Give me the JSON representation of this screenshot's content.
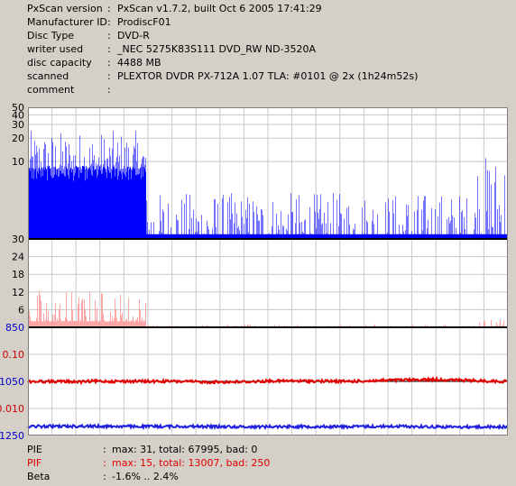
{
  "info": [
    {
      "key": "PxScan version",
      "value": "PxScan v1.7.2, built Oct  6 2005 17:41:29"
    },
    {
      "key": "Manufacturer ID",
      "value": "ProdiscF01"
    },
    {
      "key": "Disc Type",
      "value": "DVD-R"
    },
    {
      "key": "writer used",
      "value": "_NEC 5275K83S111 DVD_RW ND-3520A"
    },
    {
      "key": "disc capacity",
      "value": "4488 MB"
    },
    {
      "key": "scanned",
      "value": "PLEXTOR DVDR PX-712A 1.07 TLA: #0101 @ 2x (1h24m52s)"
    },
    {
      "key": "comment",
      "value": ""
    }
  ],
  "stats": [
    {
      "key": "PIE",
      "value": "max: 31, total: 67995, bad: 0",
      "color": "#000000"
    },
    {
      "key": "PIF",
      "value": "max: 15, total: 13007, bad: 250",
      "color": "#e00000"
    },
    {
      "key": "Beta",
      "value": "-1.6% .. 2.4%",
      "color": "#000000"
    }
  ],
  "chart_data": [
    {
      "type": "area",
      "scale": "log",
      "ylim": [
        1,
        50
      ],
      "ytick_labels": [
        "50",
        "40",
        "30",
        "20",
        "10"
      ],
      "color": "#0000ff",
      "x_range": [
        0,
        4488
      ],
      "max": 31,
      "segments": [
        {
          "x": [
            0,
            1100
          ],
          "typical": 8,
          "peak": 25
        },
        {
          "x": [
            1100,
            4180
          ],
          "typical": 1,
          "peak": 4
        },
        {
          "x": [
            4180,
            4488
          ],
          "typical": 1,
          "peak": 12
        }
      ]
    },
    {
      "type": "area",
      "ylim": [
        0,
        30
      ],
      "ytick_labels": [
        "30",
        "24",
        "18",
        "12",
        "6"
      ],
      "color": "#ff9090",
      "x_range": [
        0,
        4488
      ],
      "max": 15,
      "segments": [
        {
          "x": [
            0,
            1100
          ],
          "typical": 2,
          "peak": 14
        },
        {
          "x": [
            1100,
            4180
          ],
          "typical": 0,
          "peak": 1
        },
        {
          "x": [
            4180,
            4488
          ],
          "typical": 0,
          "peak": 3
        }
      ]
    },
    {
      "type": "line",
      "ytick_labels": [
        "850",
        "0.10",
        "1050",
        "-0.010",
        "1250"
      ],
      "ytick_colors": [
        "#0000cc",
        "#cc0000",
        "#0000cc",
        "#cc0000",
        "#0000cc"
      ],
      "x_range": [
        0,
        4488
      ],
      "series": [
        {
          "color": "#e00000",
          "points": [
            [
              0,
              1.7
            ],
            [
              400,
              1.6
            ],
            [
              500,
              1.4
            ],
            [
              600,
              1.8
            ],
            [
              1400,
              1.7
            ],
            [
              1700,
              1.3
            ],
            [
              2000,
              1.4
            ],
            [
              2300,
              2.0
            ],
            [
              2800,
              1.8
            ],
            [
              3000,
              1.7
            ],
            [
              3400,
              2.4
            ],
            [
              3800,
              2.9
            ],
            [
              4100,
              2.3
            ],
            [
              4488,
              1.6
            ]
          ]
        },
        {
          "color": "#2020e0",
          "points": [
            [
              0,
              -1.0
            ],
            [
              500,
              -0.8
            ],
            [
              1000,
              -1.0
            ],
            [
              1500,
              -0.9
            ],
            [
              2000,
              -1.2
            ],
            [
              2500,
              -1.0
            ],
            [
              3000,
              -1.1
            ],
            [
              3500,
              -0.9
            ],
            [
              4000,
              -1.3
            ],
            [
              4488,
              -1.2
            ]
          ]
        }
      ]
    }
  ]
}
